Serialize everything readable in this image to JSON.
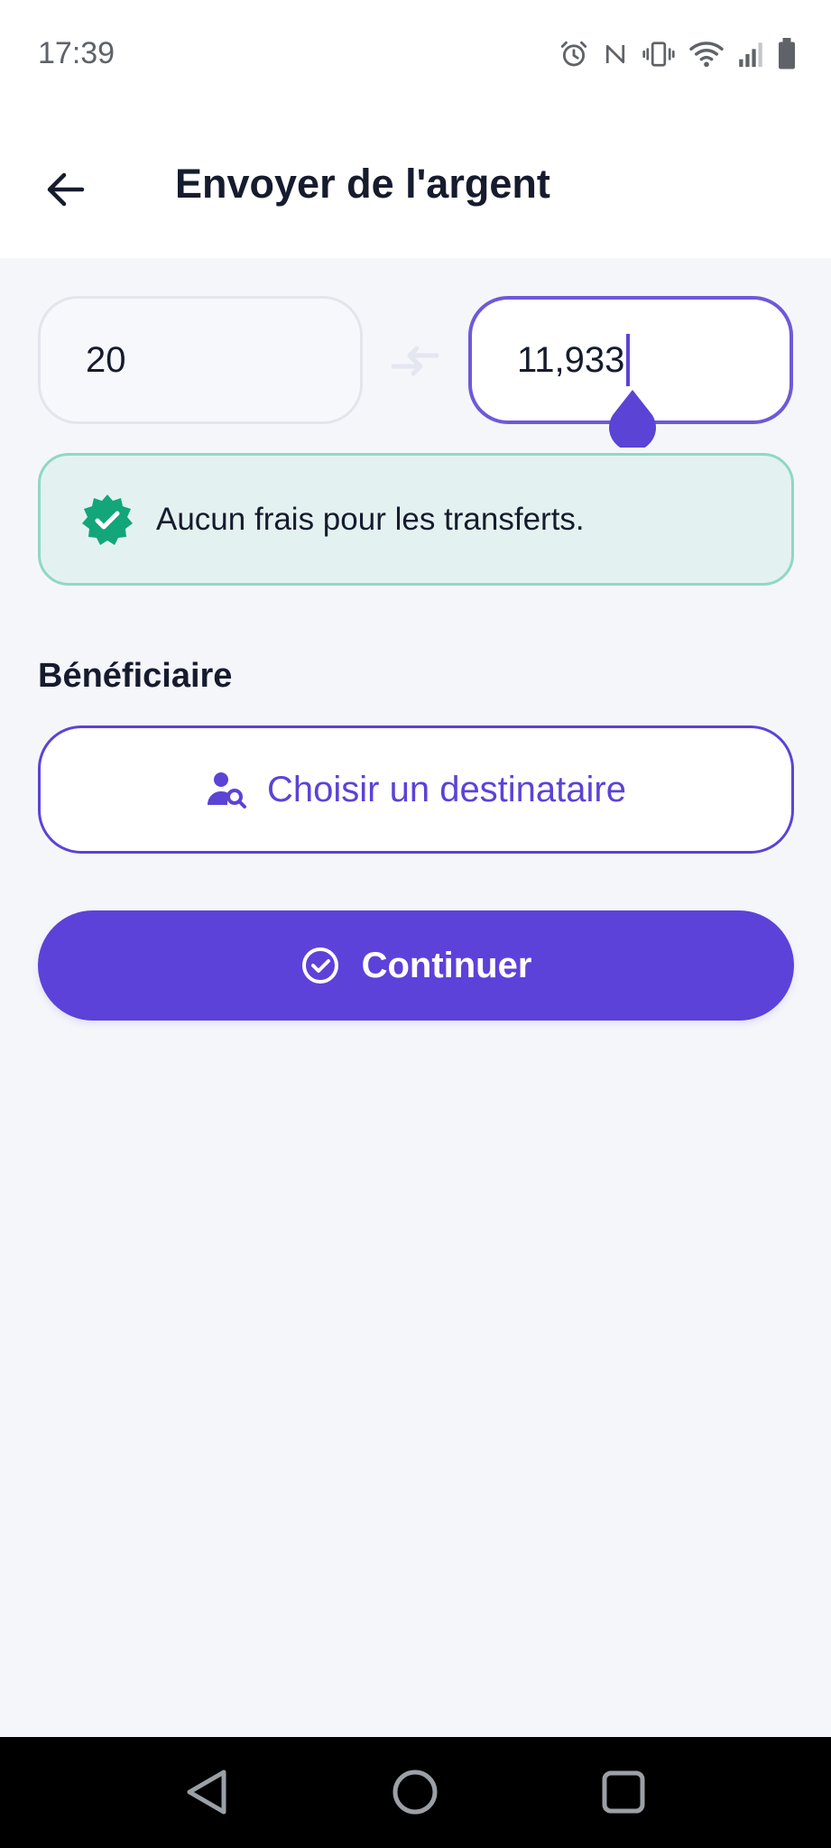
{
  "status_bar": {
    "time": "17:39",
    "icons": [
      "alarm-icon",
      "nfc-icon",
      "vibrate-icon",
      "wifi-icon",
      "signal-icon",
      "battery-icon"
    ]
  },
  "header": {
    "title": "Envoyer de l'argent",
    "back_icon": "arrow-left-icon"
  },
  "amounts": {
    "send_value": "20",
    "receive_value": "11,933",
    "swap_icon": "swap-arrows-icon"
  },
  "fee_notice": {
    "text": "Aucun frais pour les transferts.",
    "icon": "verified-badge-icon"
  },
  "recipient": {
    "section_label": "Bénéficiaire",
    "button_label": "Choisir un destinataire",
    "icon": "user-search-icon"
  },
  "continue": {
    "label": "Continuer",
    "icon": "check-circle-icon"
  },
  "nav": {
    "buttons": [
      "back-triangle-icon",
      "home-circle-icon",
      "recents-square-icon"
    ]
  },
  "colors": {
    "accent": "#5c42d9",
    "success": "#12a67a",
    "fee_bg": "#e3f2f0",
    "page_bg": "#f5f6fa"
  }
}
